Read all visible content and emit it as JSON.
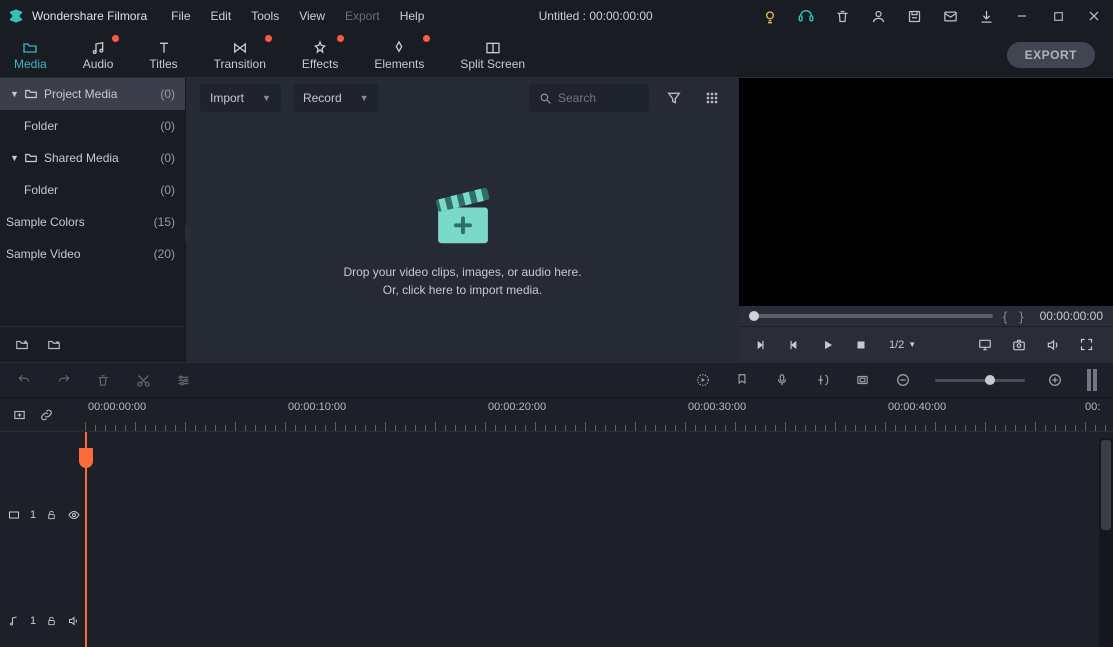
{
  "app": {
    "name": "Wondershare Filmora"
  },
  "menu": {
    "file": "File",
    "edit": "Edit",
    "tools": "Tools",
    "view": "View",
    "export": "Export",
    "help": "Help"
  },
  "title": "Untitled : 00:00:00:00",
  "tabs": {
    "media": "Media",
    "audio": "Audio",
    "titles": "Titles",
    "transition": "Transition",
    "effects": "Effects",
    "elements": "Elements",
    "split": "Split Screen"
  },
  "export_btn": "EXPORT",
  "sidebar": {
    "project": {
      "label": "Project Media",
      "count": "(0)"
    },
    "project_folder": {
      "label": "Folder",
      "count": "(0)"
    },
    "shared": {
      "label": "Shared Media",
      "count": "(0)"
    },
    "shared_folder": {
      "label": "Folder",
      "count": "(0)"
    },
    "sample_colors": {
      "label": "Sample Colors",
      "count": "(15)"
    },
    "sample_video": {
      "label": "Sample Video",
      "count": "(20)"
    }
  },
  "mediapanel": {
    "import": "Import",
    "record": "Record",
    "search_placeholder": "Search",
    "drop1": "Drop your video clips, images, or audio here.",
    "drop2": "Or, click here to import media."
  },
  "preview": {
    "timecode": "00:00:00:00",
    "ratio": "1/2"
  },
  "ruler": {
    "t0": "00:00:00:00",
    "t1": "00:00:10:00",
    "t2": "00:00:20:00",
    "t3": "00:00:30:00",
    "t4": "00:00:40:00",
    "t5": "00:"
  },
  "track": {
    "v1": "1"
  }
}
